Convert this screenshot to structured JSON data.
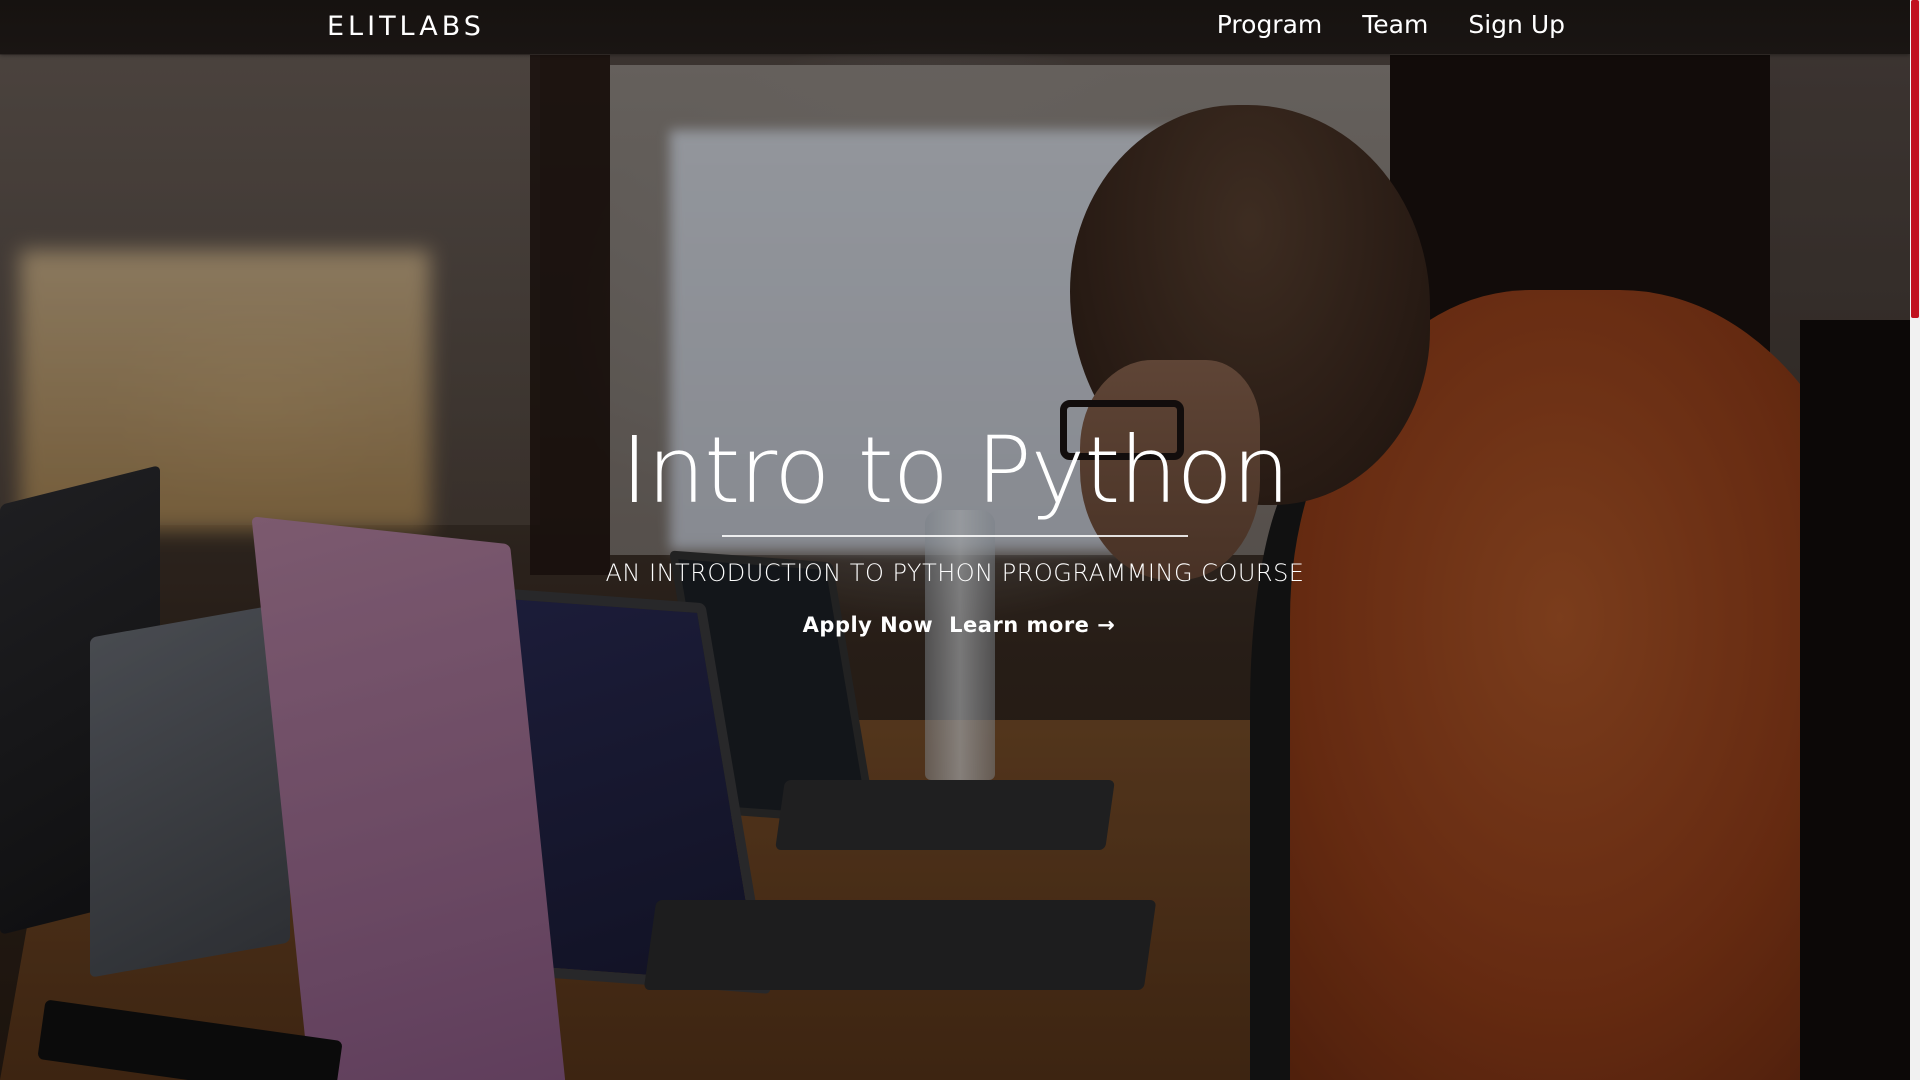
{
  "navbar": {
    "brand": "ELITLABS",
    "links": [
      "Program",
      "Team",
      "Sign Up"
    ]
  },
  "hero": {
    "title": "Intro to Python",
    "subtitle": "AN INTRODUCTION TO PYTHON PROGRAMMING COURSE",
    "primary_button": "Apply Now",
    "secondary_button": "Learn more →",
    "background_image": "classroom-laptops-photo"
  },
  "colors": {
    "overlay": "#000000",
    "text": "#ffffff",
    "scrollbar_thumb": "#c1121f"
  }
}
